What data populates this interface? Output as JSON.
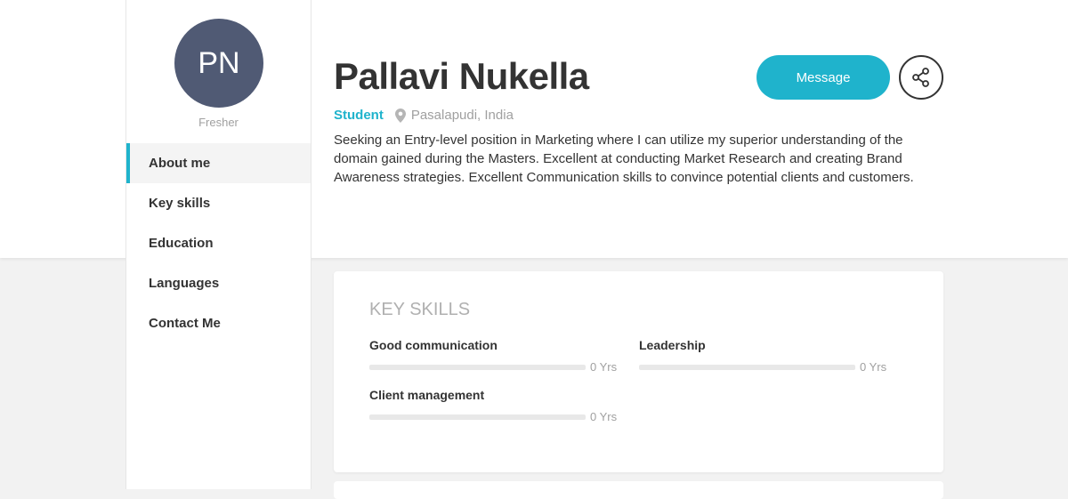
{
  "profile": {
    "initials": "PN",
    "role": "Fresher",
    "name": "Pallavi Nukella",
    "type": "Student",
    "location": "Pasalapudi, India",
    "bio": "Seeking an Entry-level position in Marketing where I can utilize my superior understanding of the domain gained during the Masters. Excellent at conducting Market Research and creating Brand Awareness strategies. Excellent Communication skills to convince potential clients and customers."
  },
  "actions": {
    "message_label": "Message",
    "share_icon": "share-icon"
  },
  "nav": {
    "items": [
      {
        "label": "About me",
        "active": true
      },
      {
        "label": "Key skills",
        "active": false
      },
      {
        "label": "Education",
        "active": false
      },
      {
        "label": "Languages",
        "active": false
      },
      {
        "label": "Contact Me",
        "active": false
      }
    ]
  },
  "key_skills": {
    "title": "KEY SKILLS",
    "skills": [
      {
        "name": "Good communication",
        "years": "0 Yrs",
        "level": 0
      },
      {
        "name": "Leadership",
        "years": "0 Yrs",
        "level": 0
      },
      {
        "name": "Client management",
        "years": "0 Yrs",
        "level": 0
      }
    ]
  },
  "colors": {
    "accent": "#1fb3cc",
    "avatar_bg": "#505a74"
  }
}
